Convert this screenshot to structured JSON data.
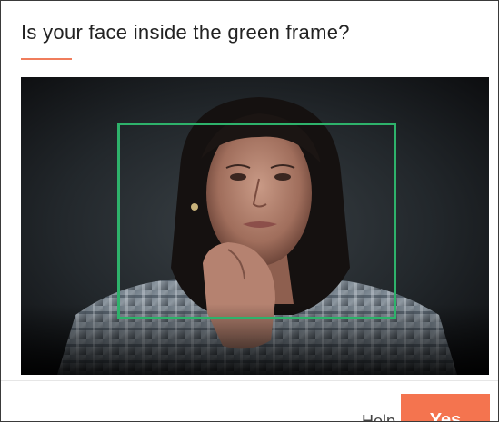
{
  "dialog": {
    "title": "Is your face inside the green frame?",
    "accent_color": "#f07d5c"
  },
  "camera": {
    "frame_color": "#2eb26b",
    "image_subject": "person"
  },
  "footer": {
    "help_label": "Help",
    "yes_label": "Yes",
    "yes_color": "#f4744f"
  }
}
